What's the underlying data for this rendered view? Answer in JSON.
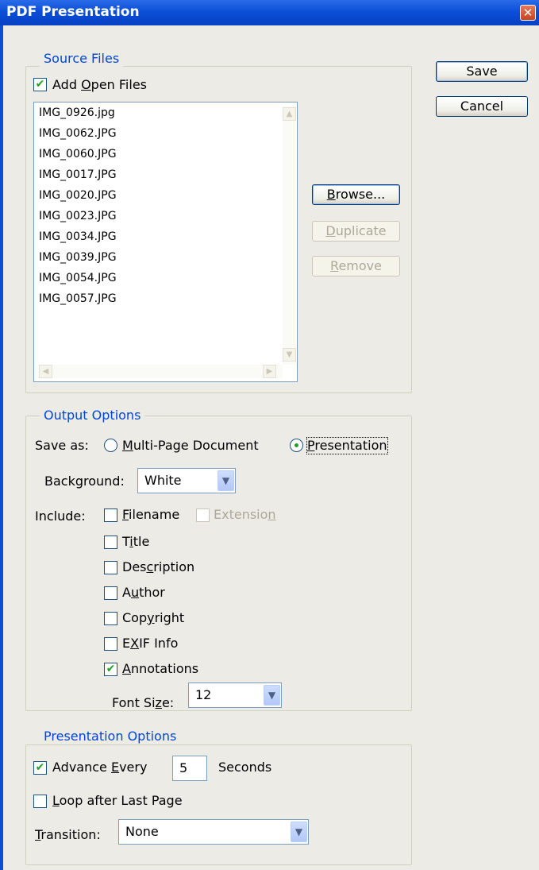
{
  "window": {
    "title": "PDF Presentation",
    "close_glyph": "✕"
  },
  "buttons": {
    "save": "Save",
    "cancel": "Cancel"
  },
  "source_files": {
    "legend": "Source Files",
    "add_open_files_label": "Add Open Files",
    "add_open_files_checked": true,
    "files": [
      "IMG_0926.jpg",
      "IMG_0062.JPG",
      "IMG_0060.JPG",
      "IMG_0017.JPG",
      "IMG_0020.JPG",
      "IMG_0023.JPG",
      "IMG_0034.JPG",
      "IMG_0039.JPG",
      "IMG_0054.JPG",
      "IMG_0057.JPG"
    ],
    "browse": "Browse...",
    "duplicate": "Duplicate",
    "remove": "Remove"
  },
  "output_options": {
    "legend": "Output Options",
    "save_as_label": "Save as:",
    "multi_page_label": "Multi-Page Document",
    "presentation_label": "Presentation",
    "selected": "Presentation",
    "background_label": "Background:",
    "background_value": "White",
    "include_label": "Include:",
    "include": {
      "filename": {
        "label": "Filename",
        "checked": false
      },
      "extension": {
        "label": "Extension",
        "checked": false,
        "disabled": true
      },
      "title": {
        "label": "Title",
        "checked": false
      },
      "description": {
        "label": "Description",
        "checked": false
      },
      "author": {
        "label": "Author",
        "checked": false
      },
      "copyright": {
        "label": "Copyright",
        "checked": false
      },
      "exif": {
        "label": "EXIF Info",
        "checked": false
      },
      "annotations": {
        "label": "Annotations",
        "checked": true
      }
    },
    "font_size_label": "Font Size:",
    "font_size_value": "12"
  },
  "presentation_options": {
    "legend": "Presentation Options",
    "advance_every_label": "Advance Every",
    "advance_every_checked": true,
    "seconds_value": "5",
    "seconds_label": "Seconds",
    "loop_label": "Loop after Last Page",
    "loop_checked": false,
    "transition_label": "Transition:",
    "transition_value": "None"
  },
  "icons": {
    "check": "✔",
    "arrow_down": "▼",
    "arrow_up": "▲",
    "arrow_left": "◀",
    "arrow_right": "▶"
  },
  "colors": {
    "titlebar": "#0a4fd6",
    "legend_text": "#0046d5",
    "dialog_bg": "#ecebe6",
    "check_green": "#21a121"
  }
}
